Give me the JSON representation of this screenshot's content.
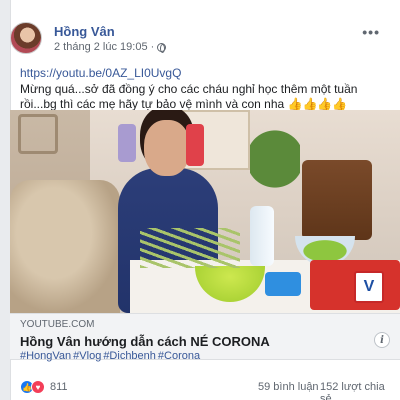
{
  "post": {
    "author": "Hồng Vân",
    "timestamp": "2 tháng 2 lúc 19:05 ·",
    "link": "https://youtu.be/0AZ_LI0UvgQ",
    "message": "Mừng quá...sở đã đồng ý cho các cháu nghỉ học thêm một tuần rồi...bg thì các mẹ hãy tự bảo vệ mình và con nha",
    "emoji": "👍👍👍👍"
  },
  "link_preview": {
    "domain": "YOUTUBE.COM",
    "title": "Hồng Vân hướng dẫn cách NÉ CORONA",
    "badge": "V"
  },
  "hashtags": [
    "#HongVan",
    "#Vlog",
    "#Dichbenh",
    "#Corona"
  ],
  "stats": {
    "reaction_count": "811",
    "comments": "59 bình luận",
    "shares": "152 lượt chia sẻ"
  },
  "icons": {
    "more": "more-options-icon",
    "privacy": "globe-icon",
    "info": "info-icon",
    "like": "like-icon",
    "love": "love-icon"
  },
  "colors": {
    "link": "#385898",
    "like": "#1877f2",
    "love": "#f33e58"
  }
}
